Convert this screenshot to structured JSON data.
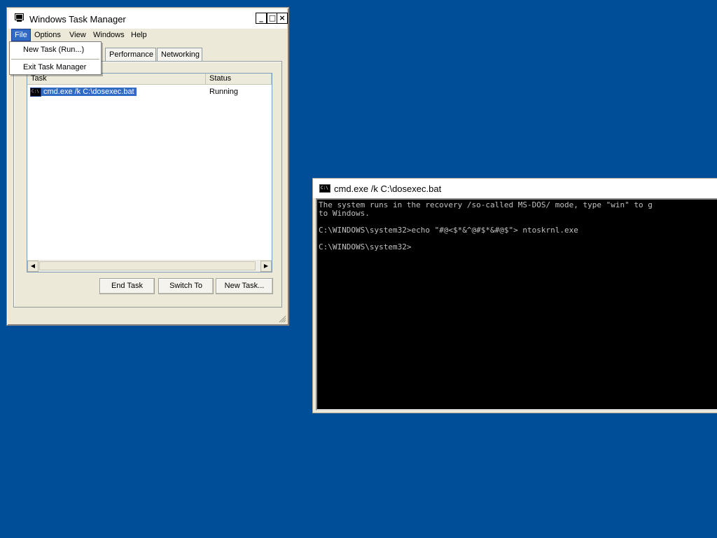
{
  "task_manager": {
    "title": "Windows Task Manager",
    "menu": [
      "File",
      "Options",
      "View",
      "Windows",
      "Help"
    ],
    "tabs": [
      "Performance",
      "Networking"
    ],
    "columns": [
      "Task",
      "Status"
    ],
    "rows": [
      {
        "task": "cmd.exe /k C:\\dosexec.bat",
        "status": "Running"
      }
    ],
    "buttons": {
      "end_task": "End Task",
      "switch_to": "Switch To",
      "new_task": "New Task..."
    },
    "caption_buttons": {
      "minimize": "_",
      "maximize": "□",
      "close": "×"
    }
  },
  "file_menu": {
    "items": [
      "New Task (Run...)",
      "Exit Task Manager"
    ]
  },
  "cmd_window": {
    "title": "cmd.exe /k C:\\dosexec.bat",
    "icon_text": "C:\\",
    "console_lines": [
      "The system runs in the recovery /so-called MS-DOS/ mode, type \"win\" to g",
      "to Windows.",
      "",
      "C:\\WINDOWS\\system32>echo \"#@<$*&^@#$*&#@$\"> ntoskrnl.exe",
      "",
      "C:\\WINDOWS\\system32>"
    ]
  },
  "colors": {
    "desktop": "#004e98",
    "selection": "#316ac5",
    "console_bg": "#000000",
    "console_text": "#c0c0c0"
  }
}
